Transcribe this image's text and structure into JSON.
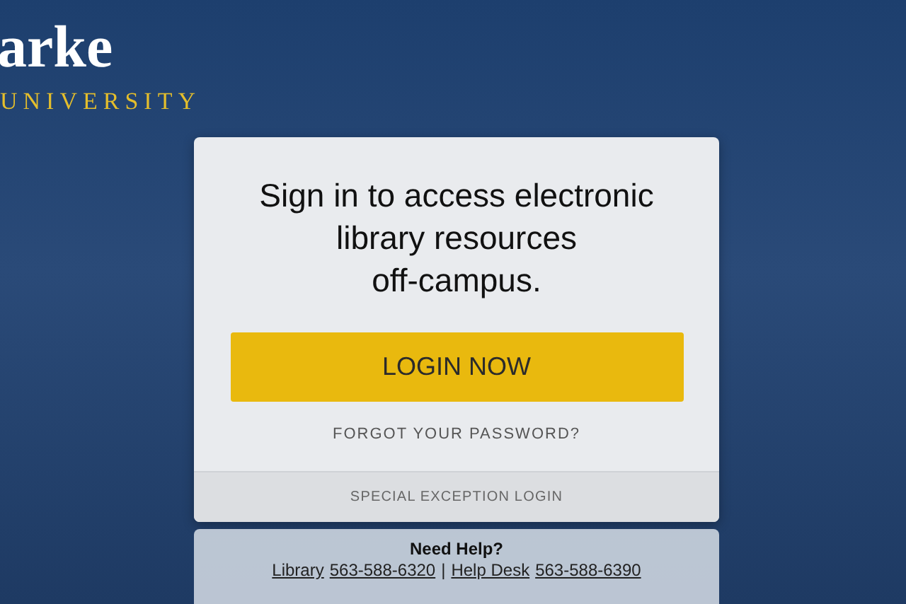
{
  "logo": {
    "wordmark": "arke",
    "tagline": "UNIVERSITY"
  },
  "card": {
    "heading": "Sign in to access electronic\nlibrary resources\noff-campus.",
    "login_button": "LOGIN NOW",
    "forgot_link": "FORGOT YOUR PASSWORD?",
    "special_link": "SPECIAL EXCEPTION LOGIN"
  },
  "help": {
    "title": "Need Help?",
    "separator": "|",
    "contacts": [
      {
        "label": "Library",
        "phone": "563-588-6320"
      },
      {
        "label": "Help Desk",
        "phone": "563-588-6390"
      }
    ]
  }
}
